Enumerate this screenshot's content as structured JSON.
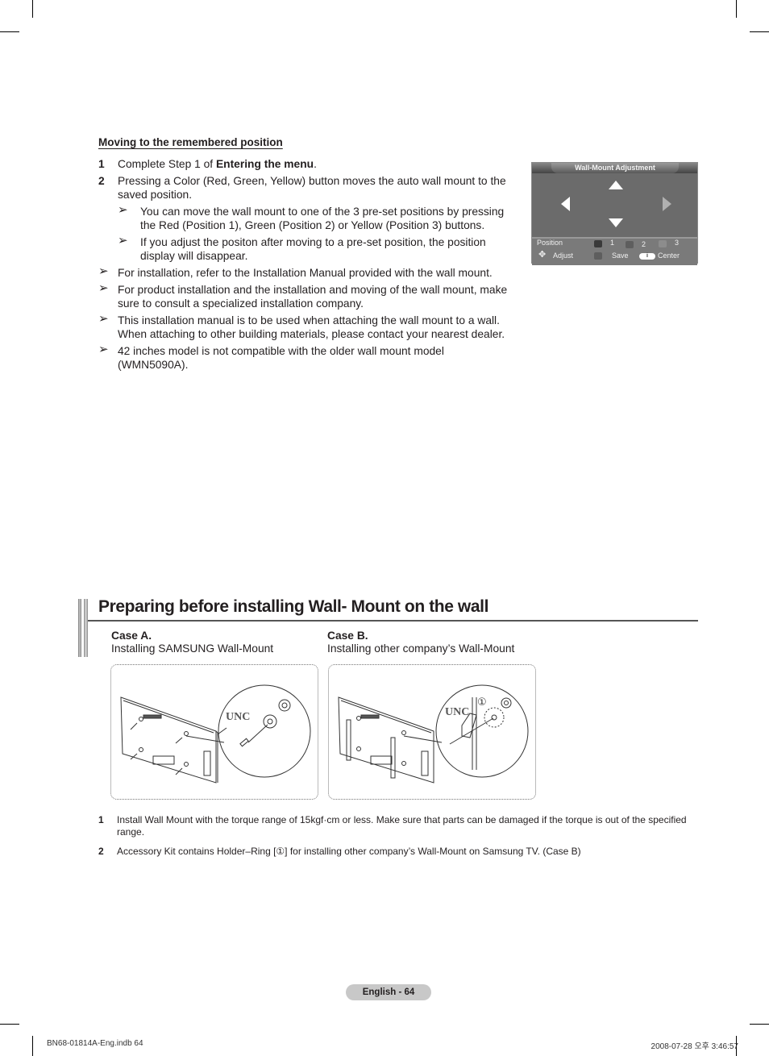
{
  "section1": {
    "title": "Moving to the remembered position",
    "steps": [
      {
        "num": "1",
        "text_pre": "Complete Step 1 of ",
        "text_bold": "Entering the menu",
        "text_post": "."
      },
      {
        "num": "2",
        "text": "Pressing a Color (Red, Green, Yellow) button moves the auto wall mount to the saved position."
      }
    ],
    "sub_notes": [
      "You can move the wall mount to one of the 3 pre-set positions by pressing the Red (Position 1), Green (Position 2) or Yellow (Position 3) buttons.",
      "If you adjust the positon after moving to a pre-set position, the position display will disappear."
    ],
    "notes": [
      "For installation, refer to the Installation Manual provided with the wall mount.",
      "For product installation and the installation and moving of the wall mount, make sure to consult a specialized installation company.",
      "This installation manual is to be used when attaching the wall mount to a wall. When attaching to other building materials, please contact your nearest dealer.",
      "42 inches model is not compatible with the older wall mount model (WMN5090A)."
    ],
    "arrow_glyph": "➢"
  },
  "osd": {
    "title": "Wall-Mount Adjustment",
    "position_label": "Position",
    "positions": [
      "1",
      "2",
      "3"
    ],
    "adjust_label": "Adjust",
    "save_label": "Save",
    "center_label": "Center",
    "center_key": "i",
    "colors": {
      "pos1": "#3a3a3a",
      "pos2": "#5e5e5e",
      "pos3": "#8c8c8c",
      "save": "#5e5e5e"
    }
  },
  "section2": {
    "title": "Preparing before installing Wall- Mount on the wall",
    "case_a": {
      "heading": "Case A.",
      "text": "Installing SAMSUNG Wall-Mount"
    },
    "case_b": {
      "heading": "Case B.",
      "text": "Installing other company’s Wall-Mount"
    },
    "figure_labels": {
      "unc": "UNC",
      "ring": "①"
    },
    "footnotes": [
      {
        "num": "1",
        "text": "Install Wall Mount with the torque range of 15kgf·cm or less. Make sure that parts can be damaged if the torque is out of the specified range."
      },
      {
        "num": "2",
        "text": "Accessory Kit contains Holder–Ring [①] for installing other company’s Wall-Mount on Samsung TV. (Case B)"
      }
    ]
  },
  "footer": {
    "page_label": "English - 64",
    "slug_left": "BN68-01814A-Eng.indb   64",
    "slug_right": "2008-07-28   오후 3:46:57"
  }
}
